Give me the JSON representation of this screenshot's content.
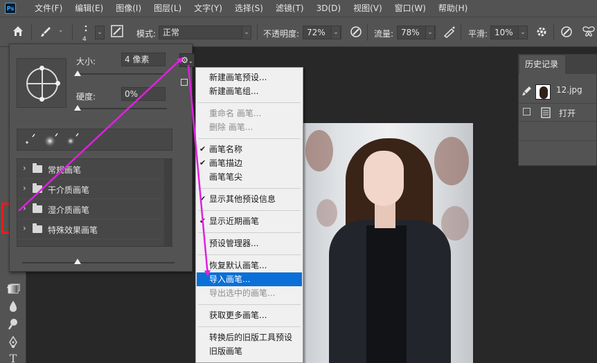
{
  "app": {
    "logo_text": "Ps"
  },
  "menubar": {
    "items": [
      "文件(F)",
      "编辑(E)",
      "图像(I)",
      "图层(L)",
      "文字(Y)",
      "选择(S)",
      "滤镜(T)",
      "3D(D)",
      "视图(V)",
      "窗口(W)",
      "帮助(H)"
    ]
  },
  "options": {
    "brush_size_value": "4",
    "mode_label": "模式:",
    "mode_value": "正常",
    "opacity_label": "不透明度:",
    "opacity_value": "72%",
    "flow_label": "流量:",
    "flow_value": "78%",
    "smoothing_label": "平滑:",
    "smoothing_value": "10%"
  },
  "brush_panel": {
    "size_label": "大小:",
    "size_value": "4 像素",
    "hardness_label": "硬度:",
    "hardness_value": "0%",
    "size_slider_fraction": 0.0,
    "hardness_slider_fraction": 0.0,
    "folders": [
      "常规画笔",
      "干介质画笔",
      "湿介质画笔",
      "特殊效果画笔"
    ]
  },
  "context_menu": {
    "items": [
      {
        "label": "新建画笔预设...",
        "disabled": false,
        "checked": false,
        "active": false
      },
      {
        "label": "新建画笔组...",
        "disabled": false,
        "checked": false,
        "active": false
      },
      {
        "sep": true
      },
      {
        "label": "重命名 画笔...",
        "disabled": true,
        "checked": false,
        "active": false
      },
      {
        "label": "删除 画笔...",
        "disabled": true,
        "checked": false,
        "active": false
      },
      {
        "sep": true
      },
      {
        "label": "画笔名称",
        "disabled": false,
        "checked": true,
        "active": false
      },
      {
        "label": "画笔描边",
        "disabled": false,
        "checked": true,
        "active": false
      },
      {
        "label": "画笔笔尖",
        "disabled": false,
        "checked": false,
        "active": false
      },
      {
        "sep": true
      },
      {
        "label": "显示其他预设信息",
        "disabled": false,
        "checked": true,
        "active": false
      },
      {
        "sep": true
      },
      {
        "label": "显示近期画笔",
        "disabled": false,
        "checked": true,
        "active": false
      },
      {
        "sep": true
      },
      {
        "label": "预设管理器...",
        "disabled": false,
        "checked": false,
        "active": false
      },
      {
        "sep": true
      },
      {
        "label": "恢复默认画笔...",
        "disabled": false,
        "checked": false,
        "active": false
      },
      {
        "label": "导入画笔...",
        "disabled": false,
        "checked": false,
        "active": true
      },
      {
        "label": "导出选中的画笔...",
        "disabled": true,
        "checked": false,
        "active": false
      },
      {
        "sep": true
      },
      {
        "label": "获取更多画笔...",
        "disabled": false,
        "checked": false,
        "active": false
      },
      {
        "sep": true
      },
      {
        "label": "转换后的旧版工具预设",
        "disabled": false,
        "checked": false,
        "active": false
      },
      {
        "label": "旧版画笔",
        "disabled": false,
        "checked": false,
        "active": false
      }
    ]
  },
  "history": {
    "tab_label": "历史记录",
    "snapshot_name": "12.jpg",
    "steps": [
      "打开"
    ]
  },
  "colors": {
    "annotation_arrow": "#e020e0",
    "annotation_box": "#ff1a1a",
    "menu_highlight": "#0a6fd6"
  }
}
